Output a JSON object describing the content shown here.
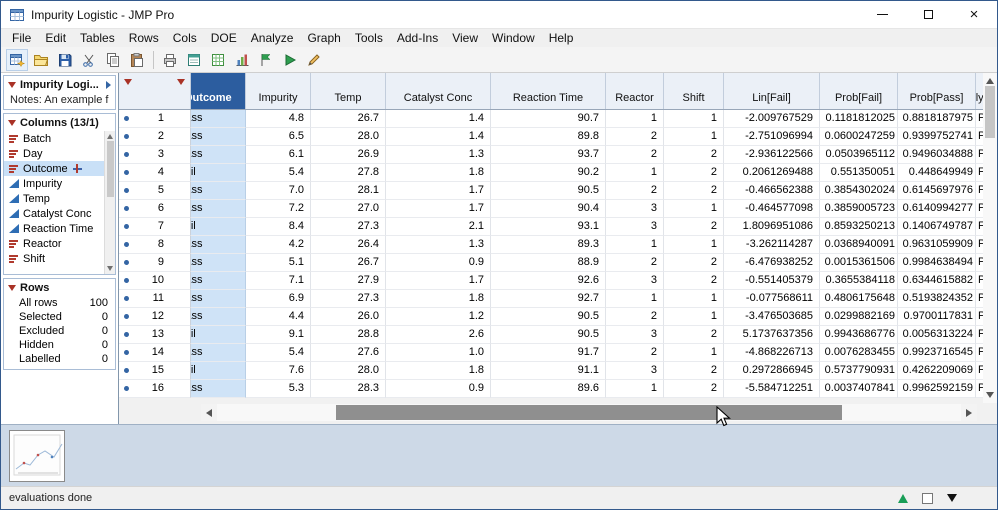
{
  "window": {
    "title": "Impurity Logistic - JMP Pro",
    "controls": [
      "minimize",
      "maximize",
      "close"
    ]
  },
  "menu_bar": {
    "items": [
      "File",
      "Edit",
      "Tables",
      "Rows",
      "Cols",
      "DOE",
      "Analyze",
      "Graph",
      "Tools",
      "Add-Ins",
      "View",
      "Window",
      "Help"
    ]
  },
  "toolbar": {
    "buttons": [
      "new-data-table",
      "open",
      "save",
      "cut",
      "copy",
      "paste",
      "separator",
      "print",
      "journal",
      "data-grid",
      "graph-builder",
      "flag",
      "run-script",
      "script-editor"
    ]
  },
  "sidebar": {
    "table_panel": {
      "title": "Impurity Logi...",
      "notes": "Notes:  An example f"
    },
    "columns_panel": {
      "title": "Columns (13/1)",
      "items": [
        {
          "label": "Batch",
          "type": "nominal"
        },
        {
          "label": "Day",
          "type": "nominal"
        },
        {
          "label": "Outcome",
          "type": "nominal",
          "selected": true,
          "formula": true
        },
        {
          "label": "Impurity",
          "type": "continuous"
        },
        {
          "label": "Temp",
          "type": "continuous"
        },
        {
          "label": "Catalyst Conc",
          "type": "continuous"
        },
        {
          "label": "Reaction Time",
          "type": "continuous"
        },
        {
          "label": "Reactor",
          "type": "nominal"
        },
        {
          "label": "Shift",
          "type": "nominal"
        }
      ]
    },
    "rows_panel": {
      "title": "Rows",
      "stats": [
        {
          "label": "All rows",
          "value": "100"
        },
        {
          "label": "Selected",
          "value": "0"
        },
        {
          "label": "Excluded",
          "value": "0"
        },
        {
          "label": "Hidden",
          "value": "0"
        },
        {
          "label": "Labelled",
          "value": "0"
        }
      ]
    }
  },
  "table": {
    "columns": [
      {
        "key": "n",
        "label": ""
      },
      {
        "key": "outcome",
        "label": "Outcome",
        "selected": true
      },
      {
        "key": "impurity",
        "label": "Impurity"
      },
      {
        "key": "temp",
        "label": "Temp"
      },
      {
        "key": "catalyst_conc",
        "label": "Catalyst Conc"
      },
      {
        "key": "reaction_time",
        "label": "Reaction Time"
      },
      {
        "key": "reactor",
        "label": "Reactor"
      },
      {
        "key": "shift",
        "label": "Shift"
      },
      {
        "key": "lin_fail",
        "label": "Lin[Fail]"
      },
      {
        "key": "prob_fail",
        "label": "Prob[Fail]"
      },
      {
        "key": "prob_pass",
        "label": "Prob[Pass]"
      },
      {
        "key": "most_likely_outcome",
        "label": "Most Likely Outcome"
      }
    ],
    "rows": [
      [
        "1",
        "Pass",
        "4.8",
        "26.7",
        "1.4",
        "90.7",
        "1",
        "1",
        "-2.009767529",
        "0.1181812025",
        "0.8818187975",
        "Pass"
      ],
      [
        "2",
        "Pass",
        "6.5",
        "28.0",
        "1.4",
        "89.8",
        "2",
        "1",
        "-2.751096994",
        "0.0600247259",
        "0.9399752741",
        "Pass"
      ],
      [
        "3",
        "Pass",
        "6.1",
        "26.9",
        "1.3",
        "93.7",
        "2",
        "2",
        "-2.936122566",
        "0.0503965112",
        "0.9496034888",
        "Pass"
      ],
      [
        "4",
        "Fail",
        "5.4",
        "27.8",
        "1.8",
        "90.2",
        "1",
        "2",
        "0.2061269488",
        "0.551350051",
        "0.448649949",
        "Fail"
      ],
      [
        "5",
        "Pass",
        "7.0",
        "28.1",
        "1.7",
        "90.5",
        "2",
        "2",
        "-0.466562388",
        "0.3854302024",
        "0.6145697976",
        "Pass"
      ],
      [
        "6",
        "Pass",
        "7.2",
        "27.0",
        "1.7",
        "90.4",
        "3",
        "1",
        "-0.464577098",
        "0.3859005723",
        "0.6140994277",
        "Pass"
      ],
      [
        "7",
        "Fail",
        "8.4",
        "27.3",
        "2.1",
        "93.1",
        "3",
        "2",
        "1.8096951086",
        "0.8593250213",
        "0.1406749787",
        "Fail"
      ],
      [
        "8",
        "Pass",
        "4.2",
        "26.4",
        "1.3",
        "89.3",
        "1",
        "1",
        "-3.262114287",
        "0.0368940091",
        "0.9631059909",
        "Pass"
      ],
      [
        "9",
        "Pass",
        "5.1",
        "26.7",
        "0.9",
        "88.9",
        "2",
        "2",
        "-6.476938252",
        "0.0015361506",
        "0.9984638494",
        "Pass"
      ],
      [
        "10",
        "Pass",
        "7.1",
        "27.9",
        "1.7",
        "92.6",
        "3",
        "2",
        "-0.551405379",
        "0.3655384118",
        "0.6344615882",
        "Pass"
      ],
      [
        "11",
        "Pass",
        "6.9",
        "27.3",
        "1.8",
        "92.7",
        "1",
        "1",
        "-0.077568611",
        "0.4806175648",
        "0.5193824352",
        "Pass"
      ],
      [
        "12",
        "Pass",
        "4.4",
        "26.0",
        "1.2",
        "90.5",
        "2",
        "1",
        "-3.476503685",
        "0.0299882169",
        "0.9700117831",
        "Pass"
      ],
      [
        "13",
        "Fail",
        "9.1",
        "28.8",
        "2.6",
        "90.5",
        "3",
        "2",
        "5.1737637356",
        "0.9943686776",
        "0.0056313224",
        "Fail"
      ],
      [
        "14",
        "Pass",
        "5.4",
        "27.6",
        "1.0",
        "91.7",
        "2",
        "1",
        "-4.868226713",
        "0.0076283455",
        "0.9923716545",
        "Pass"
      ],
      [
        "15",
        "Fail",
        "7.6",
        "28.0",
        "1.8",
        "91.1",
        "3",
        "2",
        "0.2972866945",
        "0.5737790931",
        "0.4262209069",
        "Fail"
      ],
      [
        "16",
        "Pass",
        "5.3",
        "28.3",
        "0.9",
        "89.6",
        "1",
        "2",
        "-5.584712251",
        "0.0037407841",
        "0.9962592159",
        "Pass"
      ]
    ]
  },
  "status_bar": {
    "text": "evaluations done",
    "icons": [
      "scroll-up",
      "window-box",
      "window-list-dropdown"
    ]
  }
}
